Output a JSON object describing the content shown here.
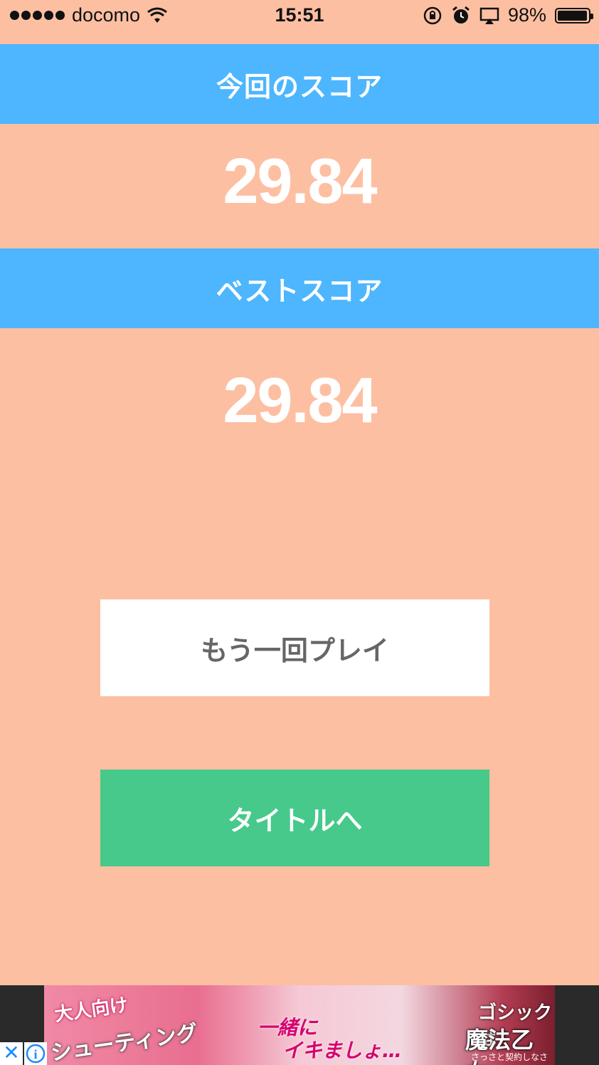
{
  "status_bar": {
    "carrier": "docomo",
    "time": "15:51",
    "battery": "98%",
    "battery_level": 0.98
  },
  "current_score": {
    "label": "今回のスコア",
    "value": "29.84"
  },
  "best_score": {
    "label": "ベストスコア",
    "value": "29.84"
  },
  "buttons": {
    "retry": "もう一回プレイ",
    "title": "タイトルへ"
  },
  "ad": {
    "close": "✕",
    "info": "i",
    "text_a": "大人向け",
    "text_b": "シューティング",
    "text_c": "一緒に",
    "text_d": "イキましょ…",
    "text_e": "ゴシックは",
    "text_f": "魔法乙女",
    "text_g": "さっさと契約しなさい!"
  },
  "colors": {
    "background": "#fdbfa2",
    "band": "#4db6fe",
    "retry_button": "#ffffff",
    "title_button": "#46c98a"
  }
}
